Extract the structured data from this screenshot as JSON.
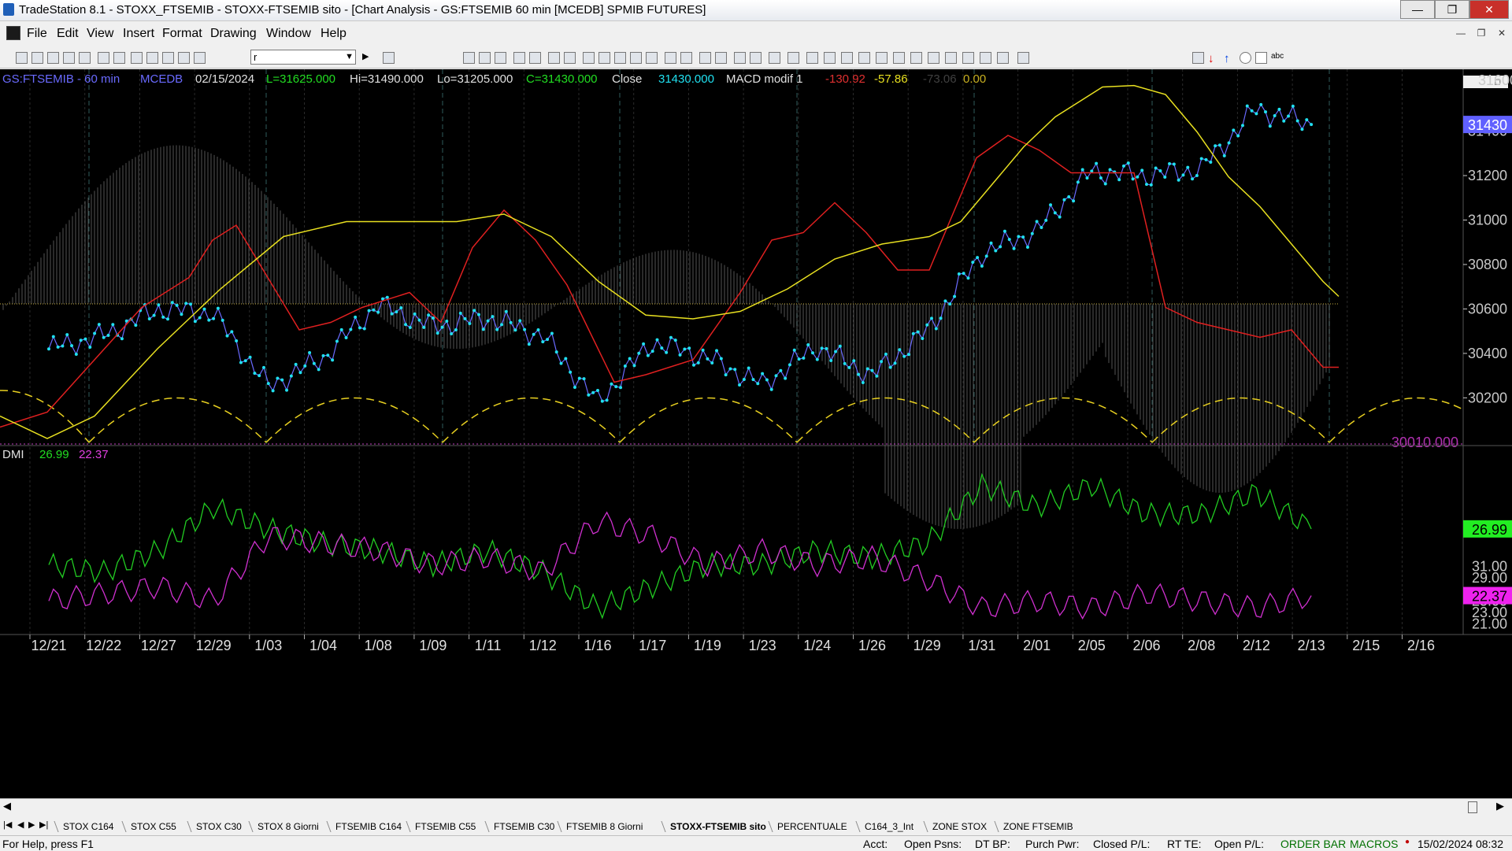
{
  "window": {
    "title": "TradeStation 8.1 - STOXX_FTSEMIB - STOXX-FTSEMIB sito - [Chart Analysis - GS:FTSEMIB  60 min  [MCEDB] SPMIB FUTURES]"
  },
  "menu": [
    "File",
    "Edit",
    "View",
    "Insert",
    "Format",
    "Drawing",
    "Window",
    "Help"
  ],
  "toolbar": {
    "symbol_field": "r"
  },
  "price_header": {
    "symbol": "GS:FTSEMIB - 60 min",
    "data_source": "MCEDB",
    "date": "02/15/2024",
    "last": "L=31625.000",
    "high": "Hi=31490.000",
    "low": "Lo=31205.000",
    "close": "C=31430.000",
    "close_label": "Close",
    "close_value": "31430.000",
    "indicator": "MACD modif 1",
    "ind_v1": "-130.92",
    "ind_v2": "-57.86",
    "ind_v3": "-73.06",
    "ind_v4": "0.00"
  },
  "price_axis": {
    "ticks": [
      "31400",
      "31200",
      "31000",
      "30800",
      "30600",
      "30400",
      "30200"
    ],
    "top_tick_partial": "31600",
    "last_price_badge": "31430",
    "reference_level": "30010.000"
  },
  "dmi_panel": {
    "title": "DMI",
    "v1": "26.99",
    "v2": "22.37",
    "axis_ticks": [
      "31.00",
      "29.00",
      "25.00",
      "23.00",
      "21.00"
    ],
    "badge_green": "26.99",
    "badge_magenta": "22.37"
  },
  "time_axis": [
    "12/21",
    "12/22",
    "12/27",
    "12/29",
    "1/03",
    "1/04",
    "1/08",
    "1/09",
    "1/11",
    "1/12",
    "1/16",
    "1/17",
    "1/19",
    "1/23",
    "1/24",
    "1/26",
    "1/29",
    "1/31",
    "2/01",
    "2/05",
    "2/06",
    "2/08",
    "2/12",
    "2/13",
    "2/15",
    "2/16"
  ],
  "workspace_tabs": [
    "STOX C164",
    "STOX C55",
    "STOX  C30",
    "STOX  8 Giorni",
    "FTSEMIB C164",
    "FTSEMIB C55",
    "FTSEMIB C30",
    "FTSEMIB  8 Giorni",
    "STOXX-FTSEMIB sito",
    "PERCENTUALE",
    "C164_3_Int",
    "ZONE STOX",
    "ZONE FTSEMIB"
  ],
  "active_tab": "STOXX-FTSEMIB sito",
  "status": {
    "help": "For Help, press F1",
    "acct": "Acct:",
    "open_psns": "Open Psns:",
    "dt_bp": "DT BP:",
    "purch_pwr": "Purch Pwr:",
    "closed_pl": "Closed P/L:",
    "rt_te": "RT TE:",
    "open_pl": "Open P/L:",
    "order_bar": "ORDER BAR",
    "macros": "MACROS",
    "datetime": "15/02/2024 08:32"
  },
  "colors": {
    "background": "#000000",
    "price_line": "#6a6aff",
    "price_dots": "#20e0f0",
    "red_line": "#e02020",
    "yellow_line": "#e8e020",
    "histogram": "#9a9a9a",
    "dmi_plus": "#22cc22",
    "dmi_minus": "#d030d0",
    "badge_blue": "#6060ff"
  },
  "chart_data": [
    {
      "type": "line",
      "x": [
        "12/21",
        "12/22",
        "12/27",
        "12/29",
        "1/03",
        "1/04",
        "1/08",
        "1/09",
        "1/11",
        "1/12",
        "1/16",
        "1/17",
        "1/19",
        "1/23",
        "1/24",
        "1/26",
        "1/29",
        "1/31",
        "2/01",
        "2/05",
        "2/06",
        "2/08",
        "2/12",
        "2/13"
      ],
      "series": [
        {
          "name": "GS:FTSEMIB - 60 min",
          "values": [
            30420,
            30480,
            30600,
            30580,
            30250,
            30380,
            30620,
            30520,
            30560,
            30480,
            30180,
            30450,
            30380,
            30260,
            30430,
            30300,
            30500,
            30850,
            30950,
            31220,
            31200,
            31230,
            31500,
            31430
          ]
        }
      ],
      "ylim": [
        30010,
        31650
      ]
    },
    {
      "type": "line",
      "x": [
        "12/21",
        "12/22",
        "12/27",
        "12/29",
        "1/03",
        "1/04",
        "1/08",
        "1/09",
        "1/11",
        "1/12",
        "1/16",
        "1/17",
        "1/19",
        "1/23",
        "1/24",
        "1/26",
        "1/29",
        "1/31",
        "2/01",
        "2/05",
        "2/06",
        "2/08",
        "2/12",
        "2/13"
      ],
      "series": [
        {
          "name": "DMI",
          "values": [
            24.5,
            24.0,
            25.5,
            28.5,
            27.0,
            26.0,
            25.5,
            24.5,
            25.5,
            24.0,
            21.5,
            23.0,
            24.5,
            24.5,
            25.5,
            25.0,
            26.0,
            30.0,
            28.5,
            30.0,
            28.0,
            28.0,
            29.5,
            26.99
          ]
        },
        {
          "values": [
            22.0,
            22.5,
            23.0,
            22.0,
            26.5,
            26.0,
            25.5,
            24.5,
            25.0,
            24.0,
            27.5,
            26.5,
            24.5,
            25.5,
            24.5,
            25.0,
            23.5,
            21.5,
            22.0,
            21.5,
            22.5,
            22.0,
            21.5,
            22.37
          ]
        }
      ],
      "ylim": [
        20.0,
        32.0
      ]
    }
  ]
}
